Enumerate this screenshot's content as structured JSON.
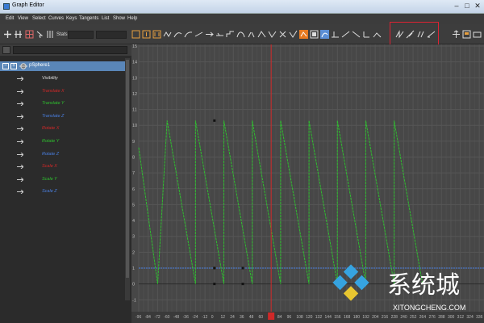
{
  "window": {
    "title": "Graph Editor",
    "min_icon": "minimize-icon",
    "max_icon": "maximize-icon",
    "close_icon": "close-icon"
  },
  "menu": [
    "Edit",
    "View",
    "Select",
    "Curves",
    "Keys",
    "Tangents",
    "List",
    "Show",
    "Help"
  ],
  "toolbar": {
    "stats_label": "Stats"
  },
  "outliner": {
    "node": "pSphere1",
    "attributes": [
      {
        "label": "Visibility",
        "color": "#dddddd"
      },
      {
        "label": "Translate X",
        "color": "#d02828"
      },
      {
        "label": "Translate Y",
        "color": "#2fbf2f"
      },
      {
        "label": "Translate Z",
        "color": "#4a7fe0"
      },
      {
        "label": "Rotate X",
        "color": "#d02828"
      },
      {
        "label": "Rotate Y",
        "color": "#2fbf2f"
      },
      {
        "label": "Rotate Z",
        "color": "#4a7fe0"
      },
      {
        "label": "Scale X",
        "color": "#d02828"
      },
      {
        "label": "Scale Y",
        "color": "#2fbf2f"
      },
      {
        "label": "Scale Z",
        "color": "#4a7fe0"
      }
    ]
  },
  "graph": {
    "y_ticks": [
      "15",
      "14",
      "13",
      "12",
      "11",
      "10",
      "9",
      "8",
      "7",
      "6",
      "5",
      "4",
      "3",
      "2",
      "1",
      "0",
      "-1"
    ],
    "x_ticks": [
      "-96",
      "-84",
      "-72",
      "-60",
      "-48",
      "-36",
      "-24",
      "-12",
      "0",
      "12",
      "24",
      "36",
      "48",
      "60",
      "72",
      "84",
      "96",
      "108",
      "120",
      "132",
      "144",
      "156",
      "168",
      "180",
      "192",
      "204",
      "216",
      "228",
      "240",
      "252",
      "264",
      "276",
      "288",
      "300",
      "312",
      "324",
      "336"
    ],
    "current_frame": "72",
    "curve_color": "#2fbf2f",
    "baseline_color": "#4a7fe0",
    "time_marker_color": "#d02828"
  },
  "watermark": {
    "text": "系统城",
    "url": "XITONGCHENG.COM"
  }
}
